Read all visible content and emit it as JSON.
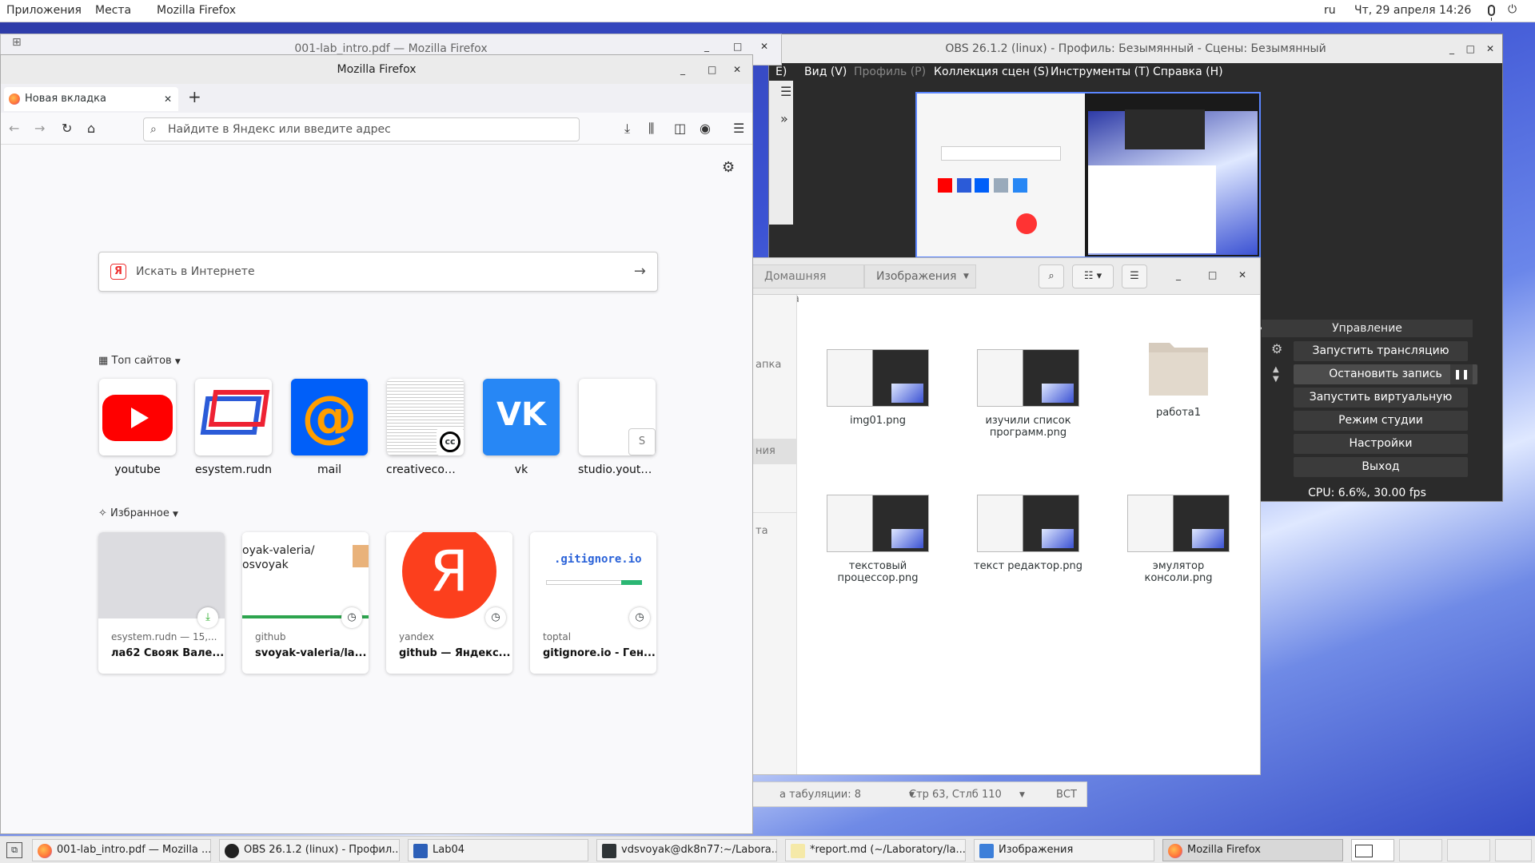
{
  "topbar": {
    "apps": "Приложения",
    "places": "Места",
    "active_app": "Mozilla Firefox",
    "lang": "ru",
    "clock": "Чт, 29 апреля  14:26"
  },
  "ff_bg": {
    "title": "001-lab_intro.pdf — Mozilla Firefox"
  },
  "obs": {
    "title": "OBS 26.1.2 (linux) - Профиль: Безымянный - Сцены: Безымянный",
    "menu": [
      "Е)",
      "Вид (V)",
      "Профиль (P)",
      "Коллекция сцен (S)",
      "Инструменты (T)",
      "Справка (H)"
    ],
    "controls_header": "Управление",
    "buttons": [
      "Запустить трансляцию",
      "Остановить запись",
      "Запустить виртуальную камеру",
      "Режим студии",
      "Настройки",
      "Выход"
    ],
    "cpu": "CPU: 6.6%, 30.00 fps",
    "side_label": "и"
  },
  "files": {
    "crumbs": [
      "Домашняя папка",
      "Изображения"
    ],
    "side": [
      "апка",
      "ния",
      "та"
    ],
    "items": [
      {
        "name": "img01.png"
      },
      {
        "name": "изучили список программ.png"
      },
      {
        "name": "работа1"
      },
      {
        "name": "текстовый процессор.png"
      },
      {
        "name": "текст редактор.png"
      },
      {
        "name": "эмулятор консоли.png"
      }
    ]
  },
  "editor": {
    "tabwidth": "а табуляции: 8",
    "pos": "Стр 63, Стлб 110",
    "mode": "ВСТ"
  },
  "firefox": {
    "title": "Mozilla Firefox",
    "tab": "Новая вкладка",
    "url_placeholder": "Найдите в Яндекс или введите адрес",
    "search_placeholder": "Искать в Интернете",
    "top_sites_label": "Топ сайтов",
    "highlights_label": "Избранное",
    "top_sites": [
      {
        "label": "youtube"
      },
      {
        "label": "esystem.rudn"
      },
      {
        "label": "mail"
      },
      {
        "label": "creativecom..."
      },
      {
        "label": "vk"
      },
      {
        "label": "studio.youtu..."
      }
    ],
    "cards": [
      {
        "source": "esystem.rudn — 15,...",
        "title": "ла62 Свояк Вале..."
      },
      {
        "source": "github",
        "title": "svoyak-valeria/la...",
        "preview": "oyak-valeria/ osvoyak"
      },
      {
        "source": "yandex",
        "title": "github — Яндекс..."
      },
      {
        "source": "toptal",
        "title": "gitignore.io - Ген...",
        "preview": ".gitignore.io"
      }
    ]
  },
  "taskbar": [
    {
      "label": "001-lab_intro.pdf — Mozilla ..."
    },
    {
      "label": "OBS 26.1.2 (linux) - Профил..."
    },
    {
      "label": "Lab04"
    },
    {
      "label": "vdsvoyak@dk8n77:~/Labora..."
    },
    {
      "label": "*report.md (~/Laboratory/la..."
    },
    {
      "label": "Изображения"
    },
    {
      "label": "Mozilla Firefox"
    }
  ],
  "colors": {
    "accent": "#0060df",
    "obs_bg": "#2b2b2b",
    "youtube": "#ff0000",
    "vk": "#2787f5",
    "mail": "#005ff9"
  }
}
